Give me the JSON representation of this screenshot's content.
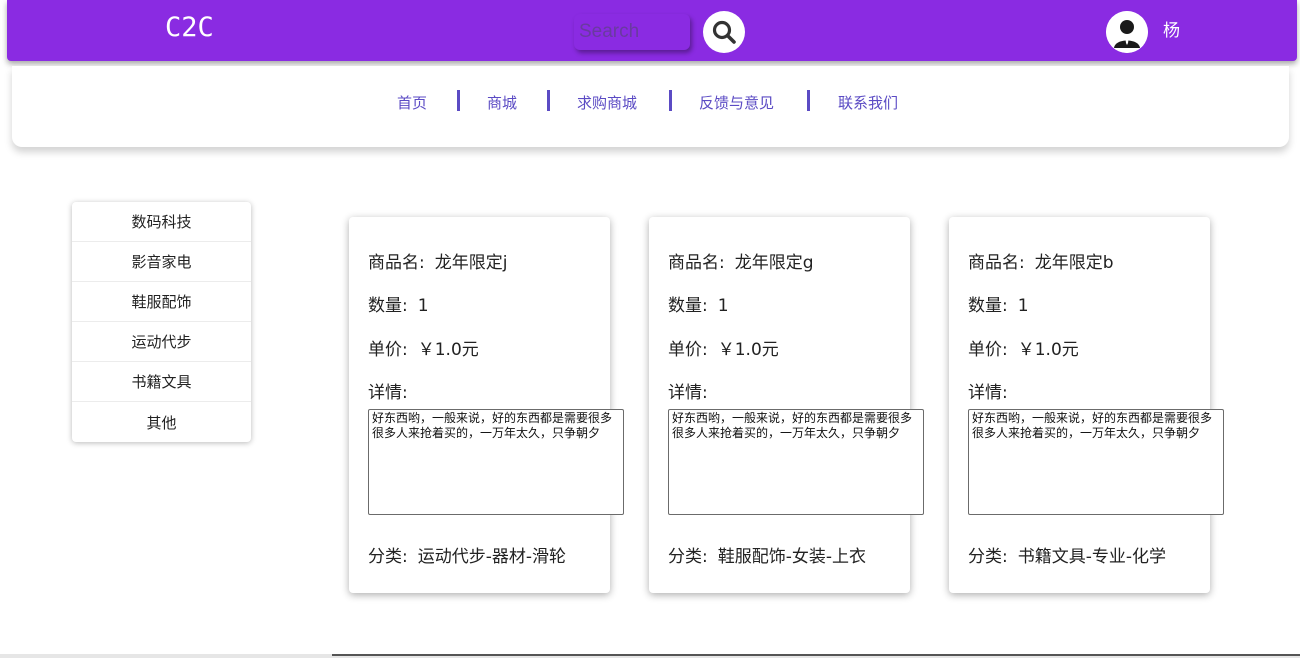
{
  "header": {
    "logo": "C2C",
    "search_placeholder": "Search",
    "search_icon": "magnifier-icon",
    "avatar_icon": "user-silhouette-icon",
    "username": "杨"
  },
  "nav": {
    "items": [
      "首页",
      "商城",
      "求购商城",
      "反馈与意见",
      "联系我们"
    ]
  },
  "sidebar": {
    "items": [
      "数码科技",
      "影音家电",
      "鞋服配饰",
      "运动代步",
      "书籍文具",
      "其他"
    ]
  },
  "cards": [
    {
      "name_label": "商品名:",
      "name": "龙年限定j",
      "qty_label": "数量:",
      "qty": "1",
      "price_label": "单价:",
      "price": "￥1.0元",
      "detail_label": "详情:",
      "detail": "好东西哟，一般来说，好的东西都是需要很多很多人来抢着买的，一万年太久，只争朝夕",
      "category_label": "分类:",
      "category": "运动代步-器材-滑轮"
    },
    {
      "name_label": "商品名:",
      "name": "龙年限定g",
      "qty_label": "数量:",
      "qty": "1",
      "price_label": "单价:",
      "price": "￥1.0元",
      "detail_label": "详情:",
      "detail": "好东西哟，一般来说，好的东西都是需要很多很多人来抢着买的，一万年太久，只争朝夕",
      "category_label": "分类:",
      "category": "鞋服配饰-女装-上衣"
    },
    {
      "name_label": "商品名:",
      "name": "龙年限定b",
      "qty_label": "数量:",
      "qty": "1",
      "price_label": "单价:",
      "price": "￥1.0元",
      "detail_label": "详情:",
      "detail": "好东西哟，一般来说，好的东西都是需要很多很多人来抢着买的，一万年太久，只争朝夕",
      "category_label": "分类:",
      "category": "书籍文具-专业-化学"
    }
  ],
  "colors": {
    "header_bg": "#8a2be2",
    "nav_text": "#5b4bc4"
  }
}
